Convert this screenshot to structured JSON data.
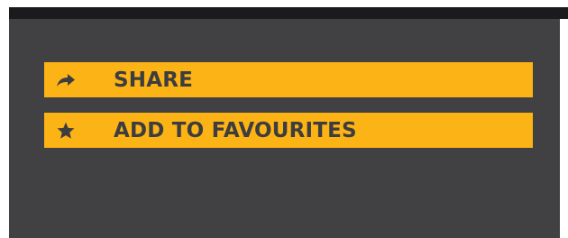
{
  "actions": [
    {
      "label": "SHARE",
      "icon": "share-arrow-icon"
    },
    {
      "label": "ADD TO FAVOURITES",
      "icon": "star-icon"
    }
  ],
  "colors": {
    "background_panel": "#414143",
    "top_bar": "#1b1b1d",
    "button_fill": "#fcb315",
    "button_text": "#3d3d3f"
  }
}
